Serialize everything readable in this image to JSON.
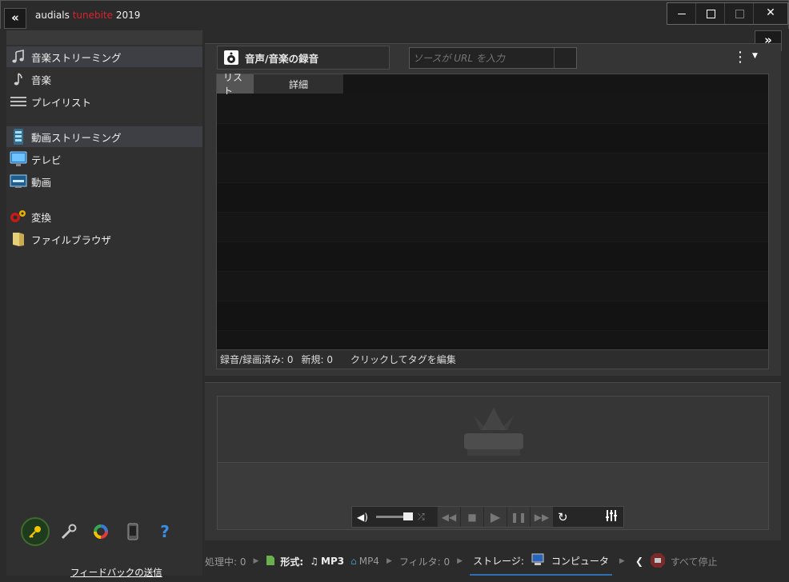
{
  "window": {
    "back_label": "«",
    "title_brand": "audials",
    "title_product": "tunebite",
    "title_year": "2019",
    "expand_label": "»",
    "controls": {
      "minimize": "",
      "maximize": "",
      "mini": "",
      "close": "✕"
    }
  },
  "sidebar": {
    "items": [
      {
        "label": "音楽ストリーミング",
        "icon": "music-streaming-icon"
      },
      {
        "label": "音楽",
        "icon": "music-note-icon"
      },
      {
        "label": "プレイリスト",
        "icon": "playlist-icon"
      },
      {
        "label": "動画ストリーミング",
        "icon": "video-streaming-icon"
      },
      {
        "label": "テレビ",
        "icon": "tv-icon"
      },
      {
        "label": "動画",
        "icon": "video-icon"
      },
      {
        "label": "変換",
        "icon": "convert-icon"
      },
      {
        "label": "ファイルブラウザ",
        "icon": "folder-icon"
      }
    ],
    "feedback": "フィードバックの送信"
  },
  "main": {
    "source_button": "音声/音楽の録音",
    "url_placeholder": "ソースが URL を入力",
    "tabs": {
      "list": "リスト",
      "details": "詳細"
    },
    "status": {
      "recorded": "録音/録画済み: 0",
      "new": "新規: 0",
      "edit_tags": "クリックしてタグを編集"
    }
  },
  "statusbar": {
    "processing": "処理中: 0",
    "format_label": "形式:",
    "format_audio": "MP3",
    "format_video": "MP4",
    "filter": "フィルタ: 0",
    "storage_label": "ストレージ:",
    "storage_value": "コンピュータ",
    "stop_all": "すべて停止"
  },
  "colors": {
    "brand_red": "#d9232e",
    "accent_blue": "#2f6fb5",
    "stop_red": "#c8232c"
  }
}
